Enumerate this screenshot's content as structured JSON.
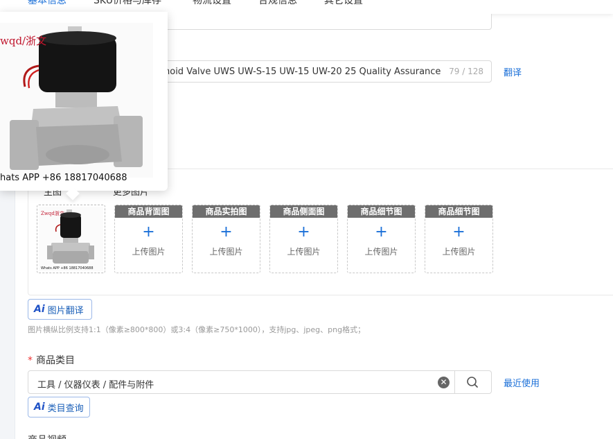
{
  "tabs": {
    "items": [
      {
        "label": "基本信息"
      },
      {
        "label": "SKU价格与库存"
      },
      {
        "label": "物流设置"
      },
      {
        "label": "合规信息"
      },
      {
        "label": "其它设置"
      }
    ]
  },
  "product_title": {
    "value": "noid Valve UWS UW-S-15 UW-15 UW-20 25 Quality Assurance",
    "count": "79 / 128",
    "translate_label": "翻译"
  },
  "images": {
    "main_label": "主图",
    "more_label": "更多图片",
    "slots": [
      {
        "header": "商品背面图",
        "plus": "+",
        "text": "上传图片"
      },
      {
        "header": "商品实拍图",
        "plus": "+",
        "text": "上传图片"
      },
      {
        "header": "商品侧面图",
        "plus": "+",
        "text": "上传图片"
      },
      {
        "header": "商品细节图",
        "plus": "+",
        "text": "上传图片"
      },
      {
        "header": "商品细节图",
        "plus": "+",
        "text": "上传图片"
      }
    ],
    "ai_translate_label": "图片翻译",
    "hint": "图片横纵比例支持1:1（像素≥800*800）或3:4（像素≥750*1000），支持jpg、jpeg、png格式；"
  },
  "preview": {
    "watermark": "wqd/浙文",
    "caption": "hats APP +86 18817040688",
    "thumb_watermark": "Zwqd浙文",
    "thumb_caption": "Whats APP +86 18817040688"
  },
  "category": {
    "label": "商品类目",
    "required_mark": "*",
    "value": "工具 / 仪器仪表 / 配件与附件",
    "recent_label": "最近使用",
    "ai_query_label": "类目查询",
    "clear_glyph": "✕"
  },
  "ai_mark": "Ai",
  "next_section_label": "商品视频",
  "colors": {
    "accent": "#1a6fd8",
    "slot_header": "#6e6e6e",
    "required": "#e33333"
  },
  "icons": [
    "search-icon",
    "clear-icon",
    "plus-icon",
    "ai-icon"
  ]
}
